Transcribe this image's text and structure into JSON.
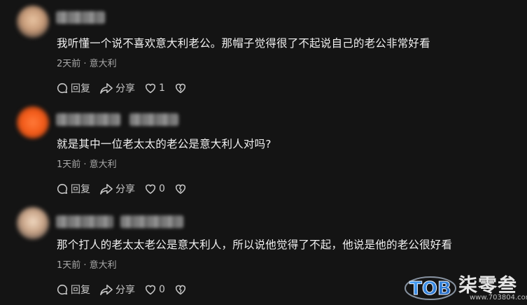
{
  "comments": [
    {
      "text": "我听懂一个说不喜欢意大利老公。那帽子觉得很了不起说自己的老公非常好看",
      "meta": "2天前 · 意大利",
      "reply_label": "回复",
      "share_label": "分享",
      "like_count": "1"
    },
    {
      "text": "就是其中一位老太太的老公是意大利人对吗?",
      "meta": "1天前 · 意大利",
      "reply_label": "回复",
      "share_label": "分享",
      "like_count": "0"
    },
    {
      "text": "那个打人的老太太老公是意大利人，所以说他觉得了不起，他说是他的老公很好看",
      "meta": "1天前 · 意大利",
      "reply_label": "回复",
      "share_label": "分享",
      "like_count": "0"
    }
  ],
  "watermark": {
    "logo_text": "TOB",
    "brand": "柒零叁",
    "url": "www.703804.com"
  },
  "colors": {
    "background": "#141414",
    "text": "#f1f1f1",
    "meta": "#a9a9a9",
    "action": "#c8c8c8"
  }
}
